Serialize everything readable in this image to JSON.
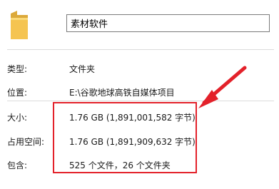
{
  "file_name": "素材软件",
  "properties": [
    {
      "label": "类型:",
      "value": "文件夹"
    },
    {
      "label": "位置:",
      "value": "E:\\谷歌地球高铁自媒体项目"
    },
    {
      "label": "大小:",
      "value": "1.76 GB (1,891,001,582 字节)"
    },
    {
      "label": "占用空间:",
      "value": "1.76 GB (1,891,909,632 字节)"
    },
    {
      "label": "包含:",
      "value": "525 个文件，26 个文件夹"
    }
  ],
  "colors": {
    "highlight": "#e3212a",
    "folder": "#f5c451"
  },
  "icons": {
    "folder": "folder-icon"
  }
}
